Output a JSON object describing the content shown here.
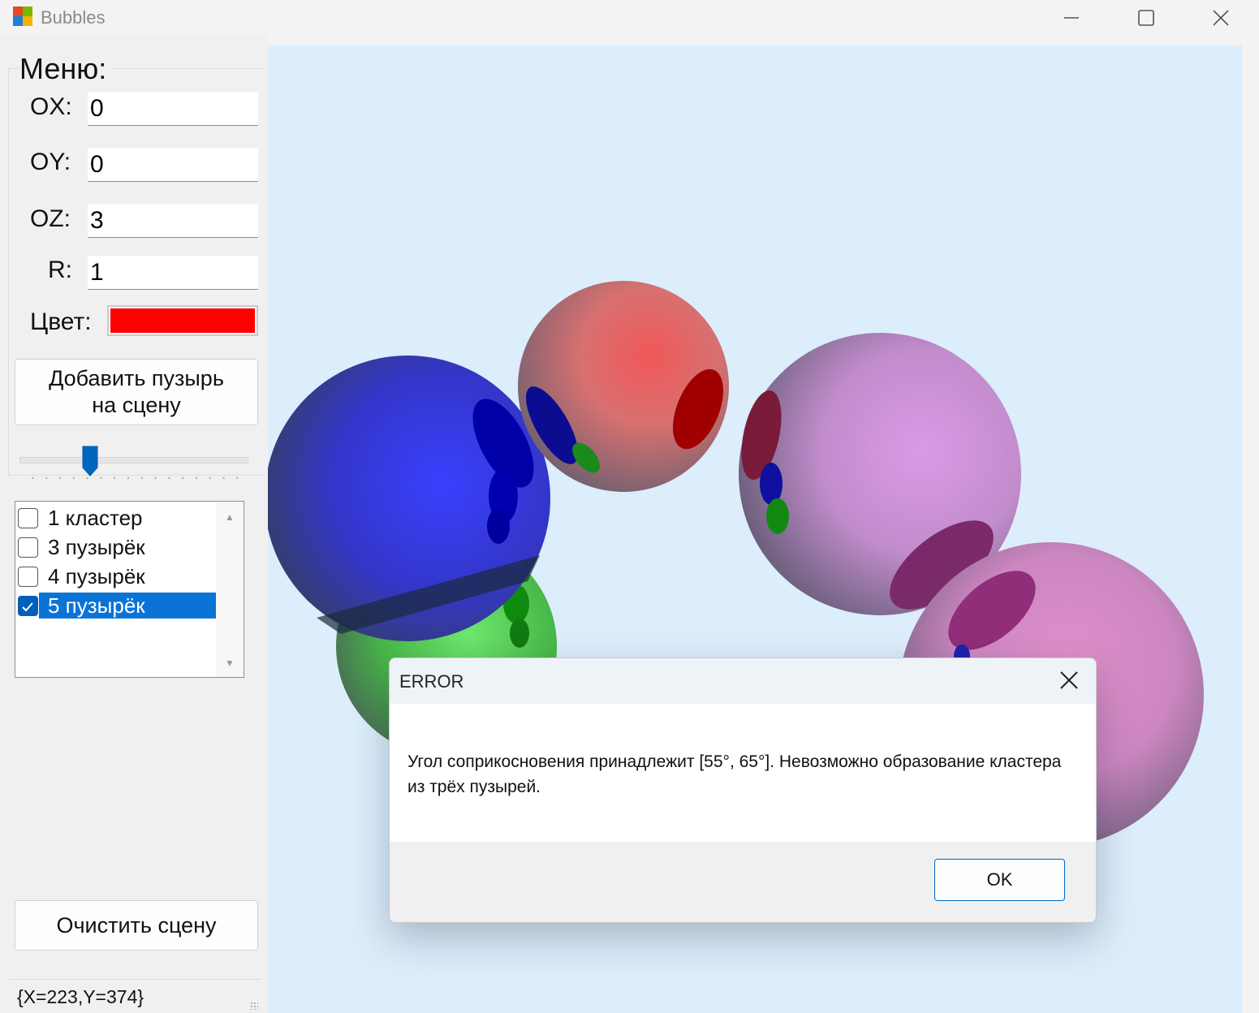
{
  "window": {
    "title": "Bubbles",
    "icon": "windows-forms-app-icon"
  },
  "menu": {
    "caption": "Меню:",
    "fields": {
      "ox": {
        "label": "OX:",
        "value": "0"
      },
      "oy": {
        "label": "OY:",
        "value": "0"
      },
      "oz": {
        "label": "OZ:",
        "value": "3"
      },
      "r": {
        "label": "R:",
        "value": "1"
      }
    },
    "color_label": "Цвет:",
    "color_value": "#ff0000",
    "add_button": {
      "line1": "Добавить пузырь",
      "line2": "на сцену"
    },
    "slider_level": 0.3,
    "list": {
      "items": [
        {
          "label": "1 кластер",
          "checked": false
        },
        {
          "label": "3 пузырёк",
          "checked": false
        },
        {
          "label": "4 пузырёк",
          "checked": false
        },
        {
          "label": "5 пузырёк",
          "checked": true
        }
      ],
      "selected_index": 3
    },
    "clear_button": "Очистить сцену",
    "status": "{X=223,Y=374}"
  },
  "scene": {
    "background": "#dcedfb",
    "bubbles": [
      {
        "color": "#2b2fd0"
      },
      {
        "color": "#e06060"
      },
      {
        "color": "#c890d8"
      },
      {
        "color": "#d888c8"
      },
      {
        "color": "#40c040"
      }
    ]
  },
  "dialog": {
    "title": "ERROR",
    "message": "Угол соприкосновения принадлежит [55°, 65°]. Невозможно образование кластера из трёх пузырей.",
    "ok_label": "OK"
  }
}
